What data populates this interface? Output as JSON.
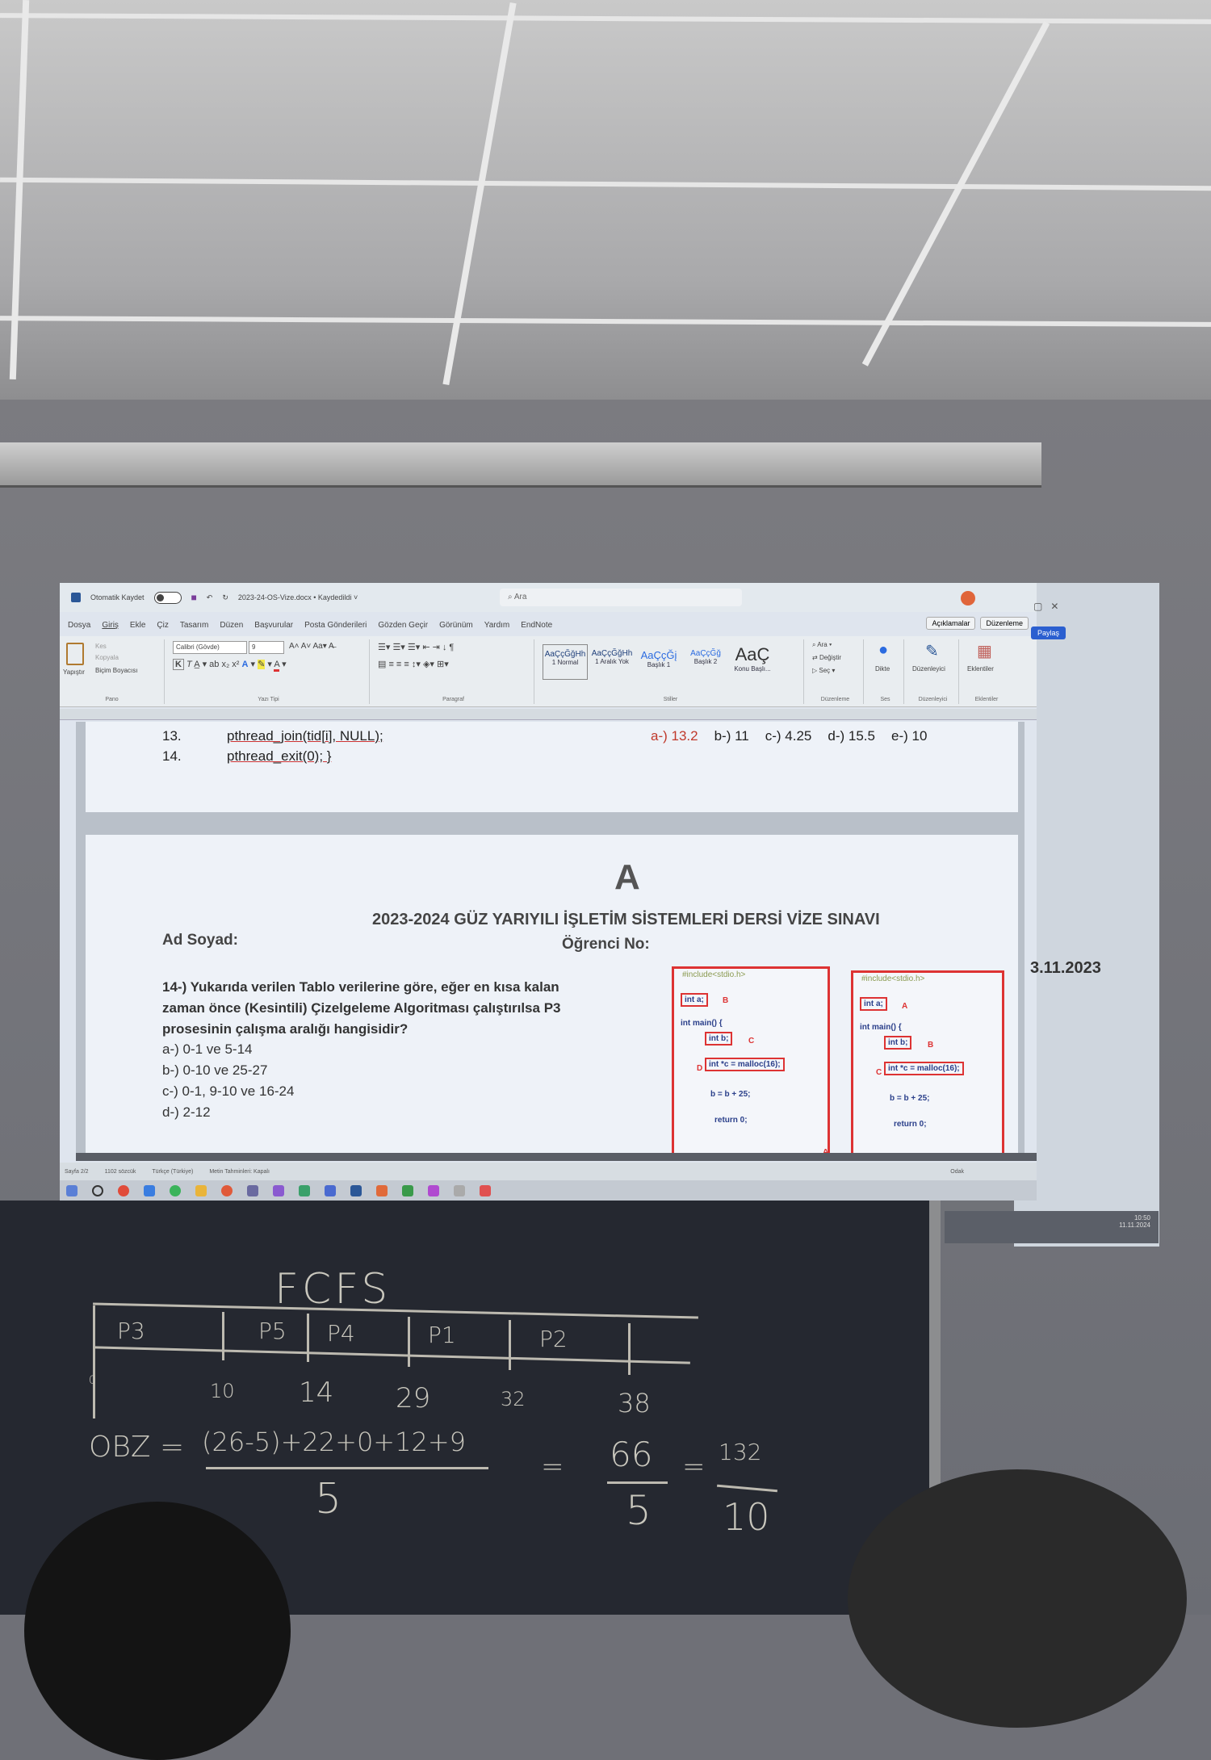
{
  "word": {
    "autosave_label": "Otomatik Kaydet",
    "document_title": "2023-24-OS-Vize.docx • Kaydedildi ˅",
    "search_placeholder": "Ara",
    "menu": [
      "Dosya",
      "Giriş",
      "Ekle",
      "Çiz",
      "Tasarım",
      "Düzen",
      "Başvurular",
      "Posta Gönderileri",
      "Gözden Geçir",
      "Görünüm",
      "Yardım",
      "EndNote"
    ],
    "active_menu": "Giriş",
    "comments_button": "Açıklamalar",
    "editing_button": "Düzenleme",
    "share_button": "Paylaş",
    "ribbon": {
      "clipboard": {
        "paste": "Yapıştır",
        "cut": "Kes",
        "copy": "Kopyala",
        "format_painter": "Biçim Boyacısı",
        "label": "Pano"
      },
      "font": {
        "name": "Calibri (Gövde)",
        "size": "9",
        "label": "Yazı Tipi"
      },
      "paragraph": {
        "label": "Paragraf"
      },
      "styles": {
        "items": [
          {
            "sample": "AaÇçĞğHh",
            "name": "1 Normal"
          },
          {
            "sample": "AaÇçĞğHh",
            "name": "1 Aralık Yok"
          },
          {
            "sample": "AaÇçĞį",
            "name": "Başlık 1"
          },
          {
            "sample": "AaÇçĞğ",
            "name": "Başlık 2"
          },
          {
            "sample": "AaÇ",
            "name": "Konu Başlı..."
          }
        ],
        "label": "Stiller"
      },
      "editing": {
        "find": "Ara",
        "replace": "Değiştir",
        "select": "Seç",
        "label": "Düzenleme"
      },
      "voice": {
        "dictate": "Dikte",
        "label": "Ses"
      },
      "editor": {
        "name": "Düzenleyici",
        "label": "Düzenleyici"
      },
      "addins": {
        "name": "Eklentiler",
        "label": "Eklentiler"
      }
    },
    "document": {
      "code_lines": [
        {
          "num": "13.",
          "code": "pthread_join(tid[i], NULL);"
        },
        {
          "num": "14.",
          "code": "pthread_exit(0); }"
        }
      ],
      "prev_answers": [
        {
          "text": "a-) 13.2",
          "correct": true
        },
        {
          "text": "b-) 11"
        },
        {
          "text": "c-) 4.25"
        },
        {
          "text": "d-) 15.5"
        },
        {
          "text": "e-) 10"
        }
      ],
      "booklet": "A",
      "exam_title": "2023-2024 GÜZ YARIYILI İŞLETİM SİSTEMLERİ DERSİ VİZE SINAVI",
      "name_label": "Ad Soyad:",
      "student_no_label": "Öğrenci No:",
      "date": "3.11.2023",
      "question": [
        "14-) Yukarıda verilen Tablo verilerine göre, eğer en kısa kalan",
        "zaman önce (Kesintili) Çizelgeleme Algoritması çalıştırılsa P3",
        "prosesinin çalışma aralığı hangisidir?"
      ],
      "options": [
        {
          "text": "a-) 0-1 ve 5-14"
        },
        {
          "text": "b-) 0-10 ve 25-27"
        },
        {
          "text": "c-) 0-1, 9-10 ve 16-24",
          "correct": true
        },
        {
          "text": "d-) 2-12"
        }
      ],
      "code_boxes": [
        {
          "include": "#include<stdio.h>",
          "a": "int a;",
          "a_tag": "B",
          "main": "int main() {",
          "b": "int b;",
          "b_tag": "C",
          "c": "int *c = malloc(16);",
          "c_tag": "D",
          "assign": "b = b + 25;",
          "ret": "return 0;",
          "corner": "A"
        },
        {
          "include": "#include<stdio.h>",
          "a": "int a;",
          "a_tag": "A",
          "main": "int main() {",
          "b": "int b;",
          "b_tag": "B",
          "c": "int *c = malloc(16);",
          "c_tag": "C",
          "assign": "b = b + 25;",
          "ret": "return 0;"
        }
      ]
    },
    "status": {
      "page": "Sayfa 2/2",
      "words": "1102 sözcük",
      "language": "Türkçe (Türkiye)",
      "predictions": "Metin Tahminleri: Kapalı",
      "focus": "Odak"
    },
    "clock": {
      "time": "10:50",
      "date": "11.11.2024"
    }
  },
  "chalkboard": {
    "title": "FCFS",
    "gantt": [
      "P3",
      "P5",
      "P4",
      "P1",
      "P2"
    ],
    "times": [
      "0",
      "10",
      "14",
      "29",
      "32",
      "38"
    ],
    "formula": {
      "lhs": "OBZ =",
      "numerator": "(26-5)+22+0+12+9",
      "denominator": "5",
      "eq1": "=",
      "frac2_num": "66",
      "frac2_den": "5",
      "eq2": "=",
      "frac3_num": "132",
      "frac3_den": "10"
    }
  },
  "colors": {
    "word_blue": "#2b5797",
    "answer_red": "#c0392b",
    "chalkboard": "#252830"
  }
}
